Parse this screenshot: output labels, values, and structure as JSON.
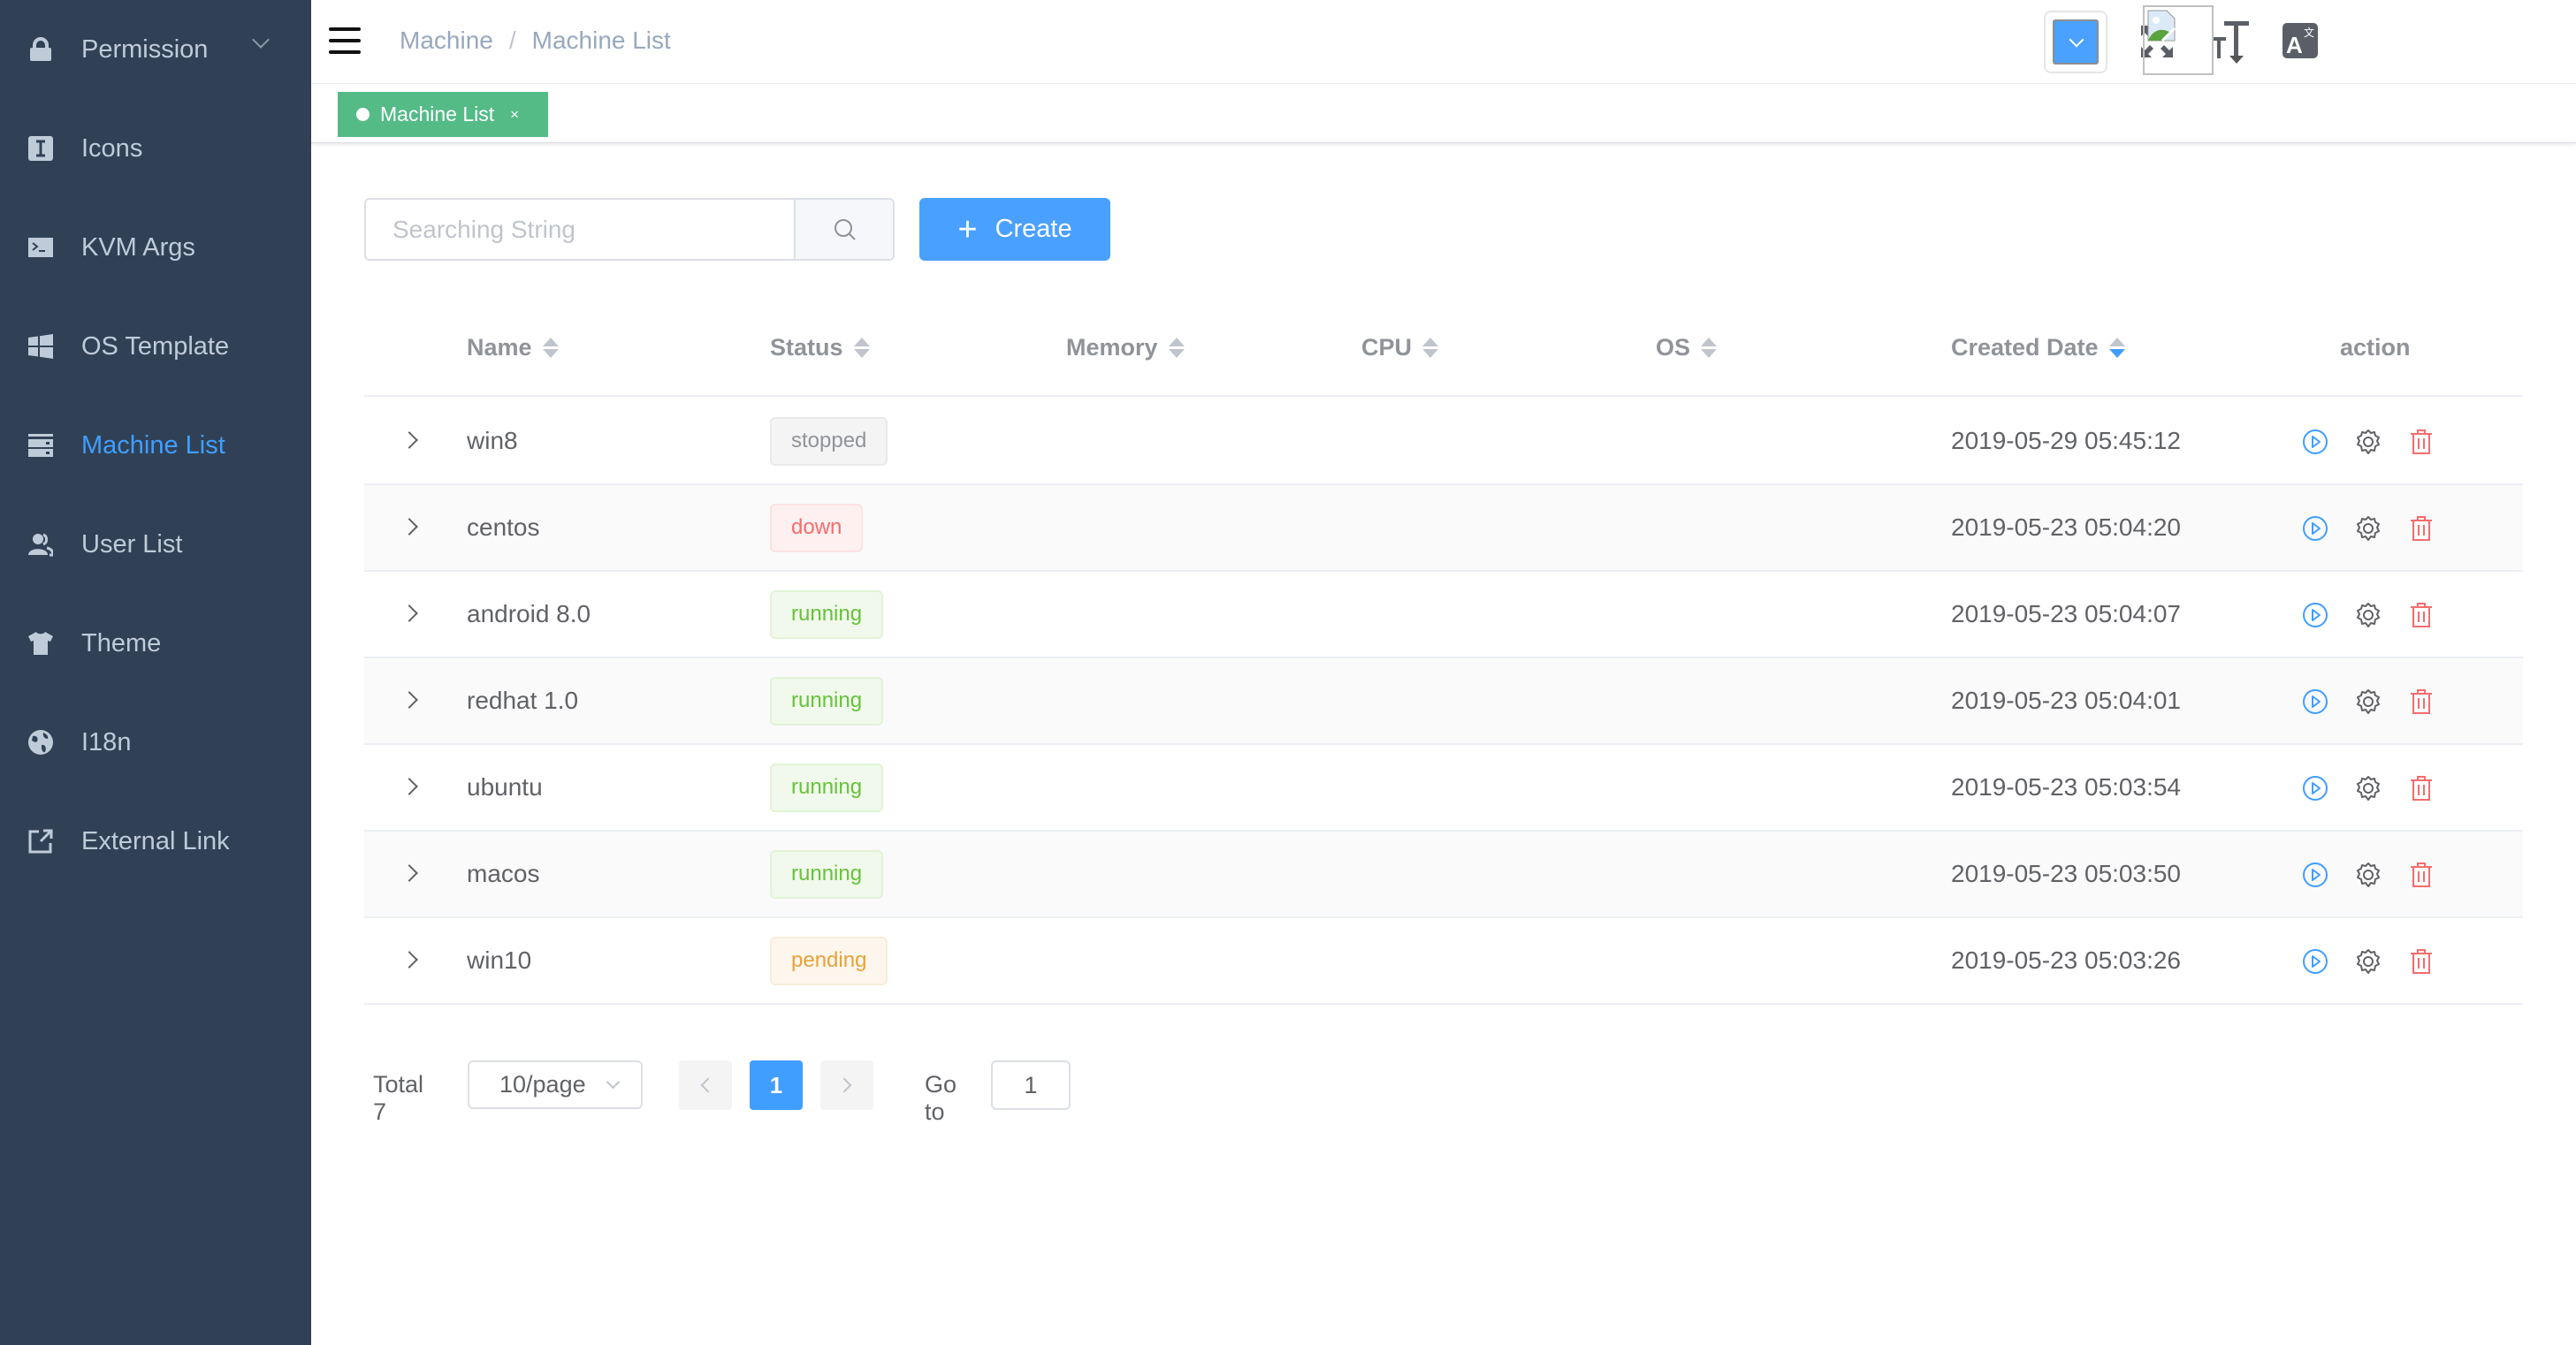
{
  "sidebar": {
    "items": [
      {
        "label": "Permission",
        "icon": "lock-icon",
        "has_submenu": true,
        "active": false
      },
      {
        "label": "Icons",
        "icon": "icons-icon",
        "active": false
      },
      {
        "label": "KVM Args",
        "icon": "terminal-icon",
        "active": false
      },
      {
        "label": "OS Template",
        "icon": "windows-icon",
        "active": false
      },
      {
        "label": "Machine List",
        "icon": "server-icon",
        "active": true
      },
      {
        "label": "User List",
        "icon": "users-icon",
        "active": false
      },
      {
        "label": "Theme",
        "icon": "shirt-icon",
        "active": false
      },
      {
        "label": "I18n",
        "icon": "globe-icon",
        "active": false
      },
      {
        "label": "External Link",
        "icon": "external-link-icon",
        "active": false
      }
    ],
    "active_color": "#409eff"
  },
  "navbar": {
    "breadcrumb": [
      "Machine",
      "Machine List"
    ],
    "breadcrumb_separator": "/",
    "theme_color": "#4aa1ff"
  },
  "tags_view": {
    "tags": [
      {
        "label": "Machine List",
        "active": true,
        "close": "×"
      }
    ],
    "active_color": "#54bb87"
  },
  "toolbar": {
    "search_placeholder": "Searching String",
    "search_value": "",
    "create_label": "Create",
    "create_icon": "+"
  },
  "table": {
    "columns": [
      {
        "label": "Name",
        "sortable": true,
        "sort": "none"
      },
      {
        "label": "Status",
        "sortable": true,
        "sort": "none"
      },
      {
        "label": "Memory",
        "sortable": true,
        "sort": "none"
      },
      {
        "label": "CPU",
        "sortable": true,
        "sort": "none"
      },
      {
        "label": "OS",
        "sortable": true,
        "sort": "none"
      },
      {
        "label": "Created Date",
        "sortable": true,
        "sort": "descending"
      },
      {
        "label": "action",
        "sortable": false
      }
    ],
    "rows": [
      {
        "name": "win8",
        "status": "stopped",
        "memory": "",
        "cpu": "",
        "os": "",
        "created": "2019-05-29 05:45:12"
      },
      {
        "name": "centos",
        "status": "down",
        "memory": "",
        "cpu": "",
        "os": "",
        "created": "2019-05-23 05:04:20"
      },
      {
        "name": "android 8.0",
        "status": "running",
        "memory": "",
        "cpu": "",
        "os": "",
        "created": "2019-05-23 05:04:07"
      },
      {
        "name": "redhat 1.0",
        "status": "running",
        "memory": "",
        "cpu": "",
        "os": "",
        "created": "2019-05-23 05:04:01"
      },
      {
        "name": "ubuntu",
        "status": "running",
        "memory": "",
        "cpu": "",
        "os": "",
        "created": "2019-05-23 05:03:54"
      },
      {
        "name": "macos",
        "status": "running",
        "memory": "",
        "cpu": "",
        "os": "",
        "created": "2019-05-23 05:03:50"
      },
      {
        "name": "win10",
        "status": "pending",
        "memory": "",
        "cpu": "",
        "os": "",
        "created": "2019-05-23 05:03:26"
      }
    ],
    "actions": [
      "play-icon",
      "gear-icon",
      "trash-icon"
    ],
    "status_colors": {
      "stopped": "#909399",
      "down": "#f56c6c",
      "running": "#67c23a",
      "pending": "#e6a23c"
    }
  },
  "pagination": {
    "total_label": "Total 7",
    "page_size": "10/page",
    "current_page": "1",
    "goto_label": "Go to",
    "goto_value": "1"
  }
}
